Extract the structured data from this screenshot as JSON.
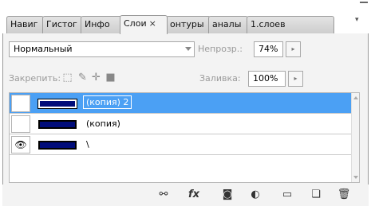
{
  "tabs": [
    {
      "label": "Навиг"
    },
    {
      "label": "Гистог"
    },
    {
      "label": "Инфо"
    },
    {
      "label": "Слои",
      "close": "×"
    },
    {
      "label": "онтуры"
    },
    {
      "label": "аналы"
    },
    {
      "label": "1.слоев"
    }
  ],
  "blend_mode": {
    "value": "Нормальный"
  },
  "opacity": {
    "label": "Непрозр.:",
    "value": "74%"
  },
  "lock": {
    "label": "Закрепить:"
  },
  "fill": {
    "label": "Заливка:",
    "value": "100%"
  },
  "layers": [
    {
      "name": "(копия) 2",
      "visible": false,
      "selected": true
    },
    {
      "name": "(копия)",
      "visible": false,
      "selected": false
    },
    {
      "name": "\\",
      "visible": true,
      "selected": false
    }
  ],
  "colors": {
    "selection": "#4ba0f4",
    "layer_fill": "#000c7a"
  },
  "toolbar_icons": [
    "link-icon",
    "fx-icon",
    "mask-icon",
    "adjustment-icon",
    "folder-icon",
    "new-layer-icon",
    "trash-icon"
  ],
  "glyphs": {
    "spin": "▸",
    "eye": "👁",
    "fx": "fx",
    "menu": "▾"
  }
}
